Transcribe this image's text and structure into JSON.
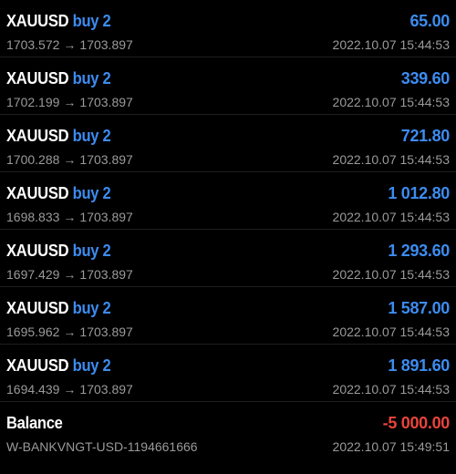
{
  "colors": {
    "background": "#000000",
    "symbol": "#ffffff",
    "side": "#3d8cf0",
    "profit": "#3d8cf0",
    "loss": "#e8453c",
    "secondary_text": "#9a9a9a"
  },
  "arrow_icon": "→",
  "trades": [
    {
      "symbol": "XAUUSD",
      "side": "buy 2",
      "open_price": "1703.572",
      "close_price": "1703.897",
      "profit": "65.00",
      "time": "2022.10.07 15:44:53"
    },
    {
      "symbol": "XAUUSD",
      "side": "buy 2",
      "open_price": "1702.199",
      "close_price": "1703.897",
      "profit": "339.60",
      "time": "2022.10.07 15:44:53"
    },
    {
      "symbol": "XAUUSD",
      "side": "buy 2",
      "open_price": "1700.288",
      "close_price": "1703.897",
      "profit": "721.80",
      "time": "2022.10.07 15:44:53"
    },
    {
      "symbol": "XAUUSD",
      "side": "buy 2",
      "open_price": "1698.833",
      "close_price": "1703.897",
      "profit": "1 012.80",
      "time": "2022.10.07 15:44:53"
    },
    {
      "symbol": "XAUUSD",
      "side": "buy 2",
      "open_price": "1697.429",
      "close_price": "1703.897",
      "profit": "1 293.60",
      "time": "2022.10.07 15:44:53"
    },
    {
      "symbol": "XAUUSD",
      "side": "buy 2",
      "open_price": "1695.962",
      "close_price": "1703.897",
      "profit": "1 587.00",
      "time": "2022.10.07 15:44:53"
    },
    {
      "symbol": "XAUUSD",
      "side": "buy 2",
      "open_price": "1694.439",
      "close_price": "1703.897",
      "profit": "1 891.60",
      "time": "2022.10.07 15:44:53"
    }
  ],
  "balance": {
    "label": "Balance",
    "comment": "W-BANKVNGT-USD-1194661666",
    "amount": "-5 000.00",
    "time": "2022.10.07 15:49:51"
  }
}
